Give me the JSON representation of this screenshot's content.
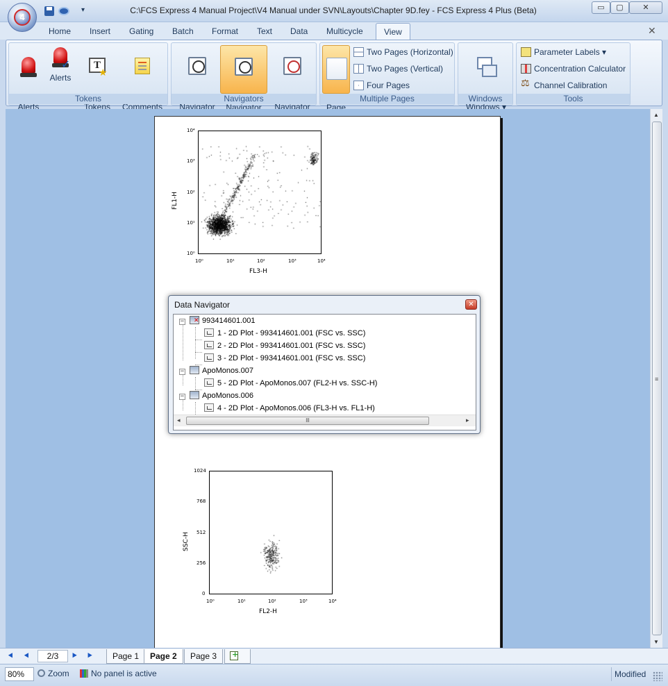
{
  "window": {
    "title": "C:\\FCS Express 4 Manual Project\\V4 Manual under SVN\\Layouts\\Chapter 9D.fey - FCS Express 4 Plus (Beta)",
    "app_badge": "4",
    "qat_more": "▾",
    "min_label": "▭",
    "max_label": "▢",
    "close_label": "✕"
  },
  "tabs": [
    {
      "label": "Home"
    },
    {
      "label": "Insert"
    },
    {
      "label": "Gating"
    },
    {
      "label": "Batch"
    },
    {
      "label": "Format"
    },
    {
      "label": "Text"
    },
    {
      "label": "Data"
    },
    {
      "label": "Multicycle"
    },
    {
      "label": "View"
    }
  ],
  "ribbon_close": "✕",
  "ribbon": {
    "tokens": {
      "label": "Tokens",
      "run_alerts": "Run\nAlerts",
      "alerts": "Alerts",
      "custom_tokens": "Custom\nTokens",
      "canned_comments": "Canned\nComments",
      "token_glyph": "T",
      "star_glyph": "★",
      "check_glyph": "✓"
    },
    "navigators": {
      "label": "Navigators",
      "layout": "Layout\nNavigator",
      "data": "Data\nNavigator",
      "gate": "Gate\nNavigator"
    },
    "multiple_pages": {
      "label": "Multiple Pages",
      "one_page": "One\nPage",
      "two_pages_h": "Two Pages (Horizontal)",
      "two_pages_v": "Two Pages (Vertical)",
      "four_pages": "Four Pages"
    },
    "windows": {
      "label": "Windows",
      "switch_windows": "Switch\nWindows ▾"
    },
    "tools": {
      "label": "Tools",
      "parameter_labels": "Parameter Labels ▾",
      "concentration_calculator": "Concentration Calculator",
      "channel_calibration": "Channel Calibration"
    }
  },
  "plots": {
    "plot1": {
      "y_label": "FL1-H",
      "x_label": "FL3-H",
      "y_ticks": [
        "10⁴",
        "10³",
        "10²",
        "10¹",
        "10⁰"
      ],
      "x_ticks": [
        "10⁰",
        "10¹",
        "10²",
        "10³",
        "10⁴"
      ]
    },
    "plot2": {
      "y_label": "SSC-H",
      "x_label": "FL2-H",
      "y_ticks": [
        "1024",
        "768",
        "512",
        "256",
        "0"
      ],
      "x_ticks": [
        "10⁰",
        "10¹",
        "10²",
        "10³",
        "10⁴"
      ]
    }
  },
  "data_navigator": {
    "title": "Data Navigator",
    "close": "✕",
    "nodes": [
      {
        "label": "993414601.001",
        "expander": "−"
      },
      {
        "label": "1 - 2D Plot - 993414601.001 (FSC vs. SSC)"
      },
      {
        "label": "2 - 2D Plot - 993414601.001 (FSC vs. SSC)"
      },
      {
        "label": "3 - 2D Plot - 993414601.001 (FSC vs. SSC)"
      },
      {
        "label": "ApoMonos.007",
        "expander": "−"
      },
      {
        "label": "5 - 2D Plot - ApoMonos.007 (FL2-H vs. SSC-H)"
      },
      {
        "label": "ApoMonos.006",
        "expander": "−"
      },
      {
        "label": "4 - 2D Plot - ApoMonos.006 (FL3-H vs. FL1-H)"
      }
    ],
    "scroll_grip": "lll",
    "scroll_left": "◂",
    "scroll_right": "▸"
  },
  "vscroll": {
    "up": "▲",
    "down": "▼",
    "grip": "≡"
  },
  "pagebar": {
    "first": "⯇",
    "prev": "⯇",
    "next": "⯈",
    "last": "⯈",
    "counter": "2/3",
    "pages": [
      {
        "label": "Page 1"
      },
      {
        "label": "Page 2"
      },
      {
        "label": "Page 3"
      }
    ]
  },
  "status": {
    "zoom_value": "80%",
    "zoom_label": "Zoom",
    "panel_status": "No panel is active",
    "modified": "Modified"
  }
}
